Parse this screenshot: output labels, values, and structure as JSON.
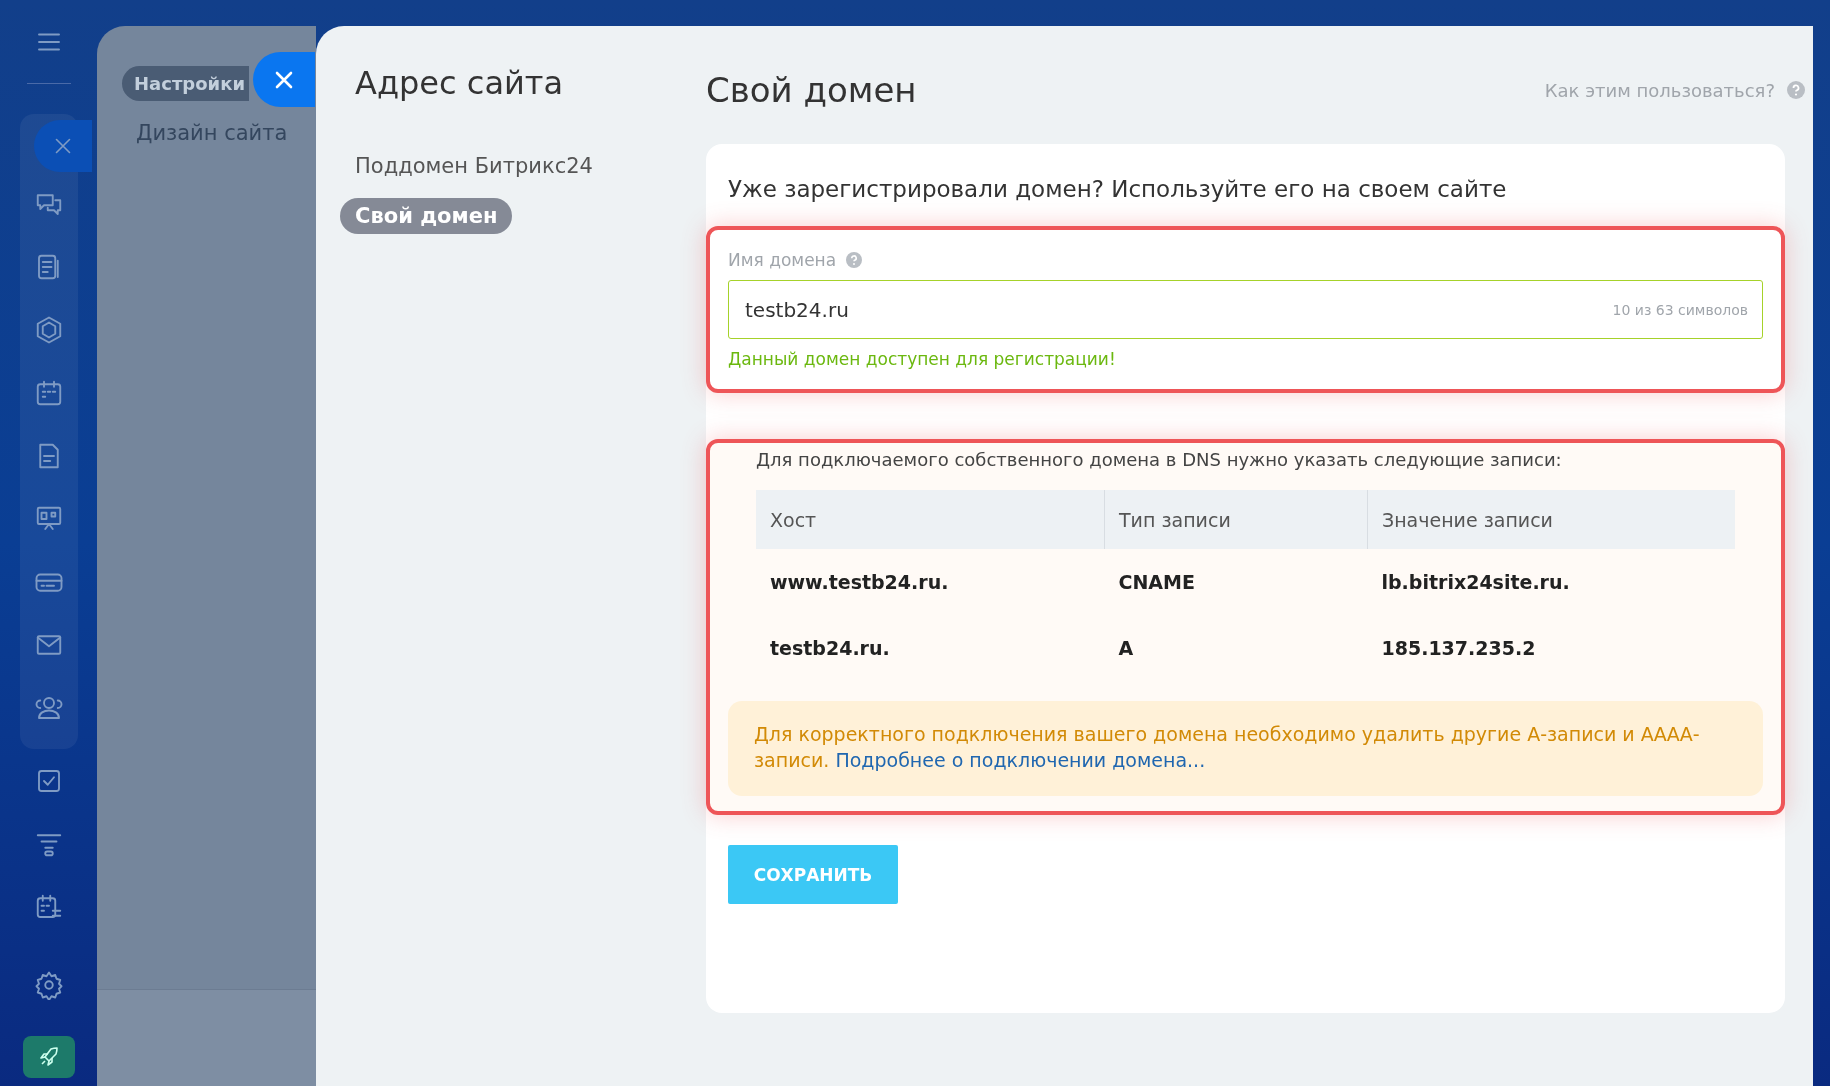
{
  "background_panel": {
    "tag": "Настройки",
    "items": [
      "Дизайн сайта"
    ]
  },
  "sidebar": {
    "title": "Адрес сайта",
    "items": [
      {
        "label": "Поддомен Битрикс24",
        "selected": false
      },
      {
        "label": "Свой домен",
        "selected": true
      }
    ]
  },
  "page": {
    "title": "Свой домен",
    "help_link": "Как этим пользоваться?"
  },
  "card": {
    "heading": "Уже зарегистрировали домен? Используйте его на своем сайте",
    "domain_field": {
      "label": "Имя домена",
      "value": "testb24.ru",
      "counter": "10 из 63 символов",
      "status": "Данный домен доступен для регистрации!"
    },
    "dns": {
      "intro": "Для подключаемого собственного домена в DNS нужно указать следующие записи:",
      "table": {
        "columns": [
          "Хост",
          "Тип записи",
          "Значение записи"
        ],
        "rows": [
          [
            "www.testb24.ru.",
            "CNAME",
            "lb.bitrix24site.ru."
          ],
          [
            "testb24.ru.",
            "A",
            "185.137.235.2"
          ]
        ]
      }
    },
    "notice": {
      "text": "Для корректного подключения вашего домена необходимо удалить другие А-записи и АААА-записи.",
      "link": "Подробнее о подключении домена..."
    },
    "save_button": "СОХРАНИТЬ"
  }
}
